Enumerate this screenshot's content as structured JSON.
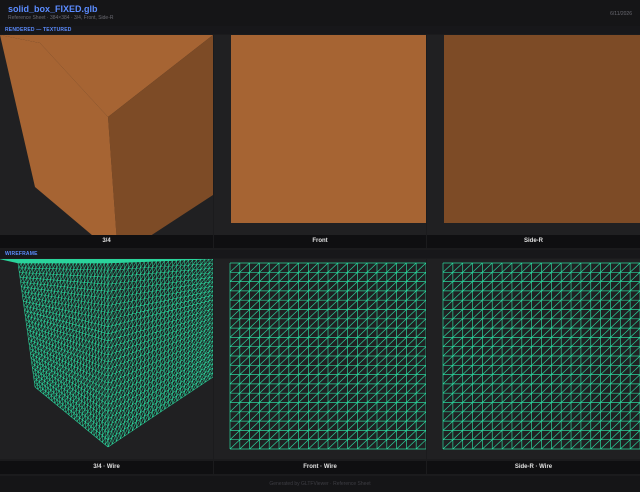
{
  "header": {
    "title": "solid_box_FIXED.glb",
    "subtitle": "Reference Sheet  ·  384×384  ·  3/4, Front, Side-R",
    "date": "6/11/2026"
  },
  "sections": {
    "rendered": "RENDERED — TEXTURED",
    "wireframe": "WIREFRAME"
  },
  "views": {
    "rendered": [
      "3/4",
      "Front",
      "Side-R"
    ],
    "wireframe": [
      "3/4 · Wire",
      "Front · Wire",
      "Side-R · Wire"
    ]
  },
  "footer": "Generated by GLTFViewer · Reference Sheet",
  "colors": {
    "front_face": "#a66433",
    "side_face": "#7d4b26",
    "wire": "#2ad39b",
    "panel_bg": "#202022",
    "accent": "#5b8cff"
  }
}
